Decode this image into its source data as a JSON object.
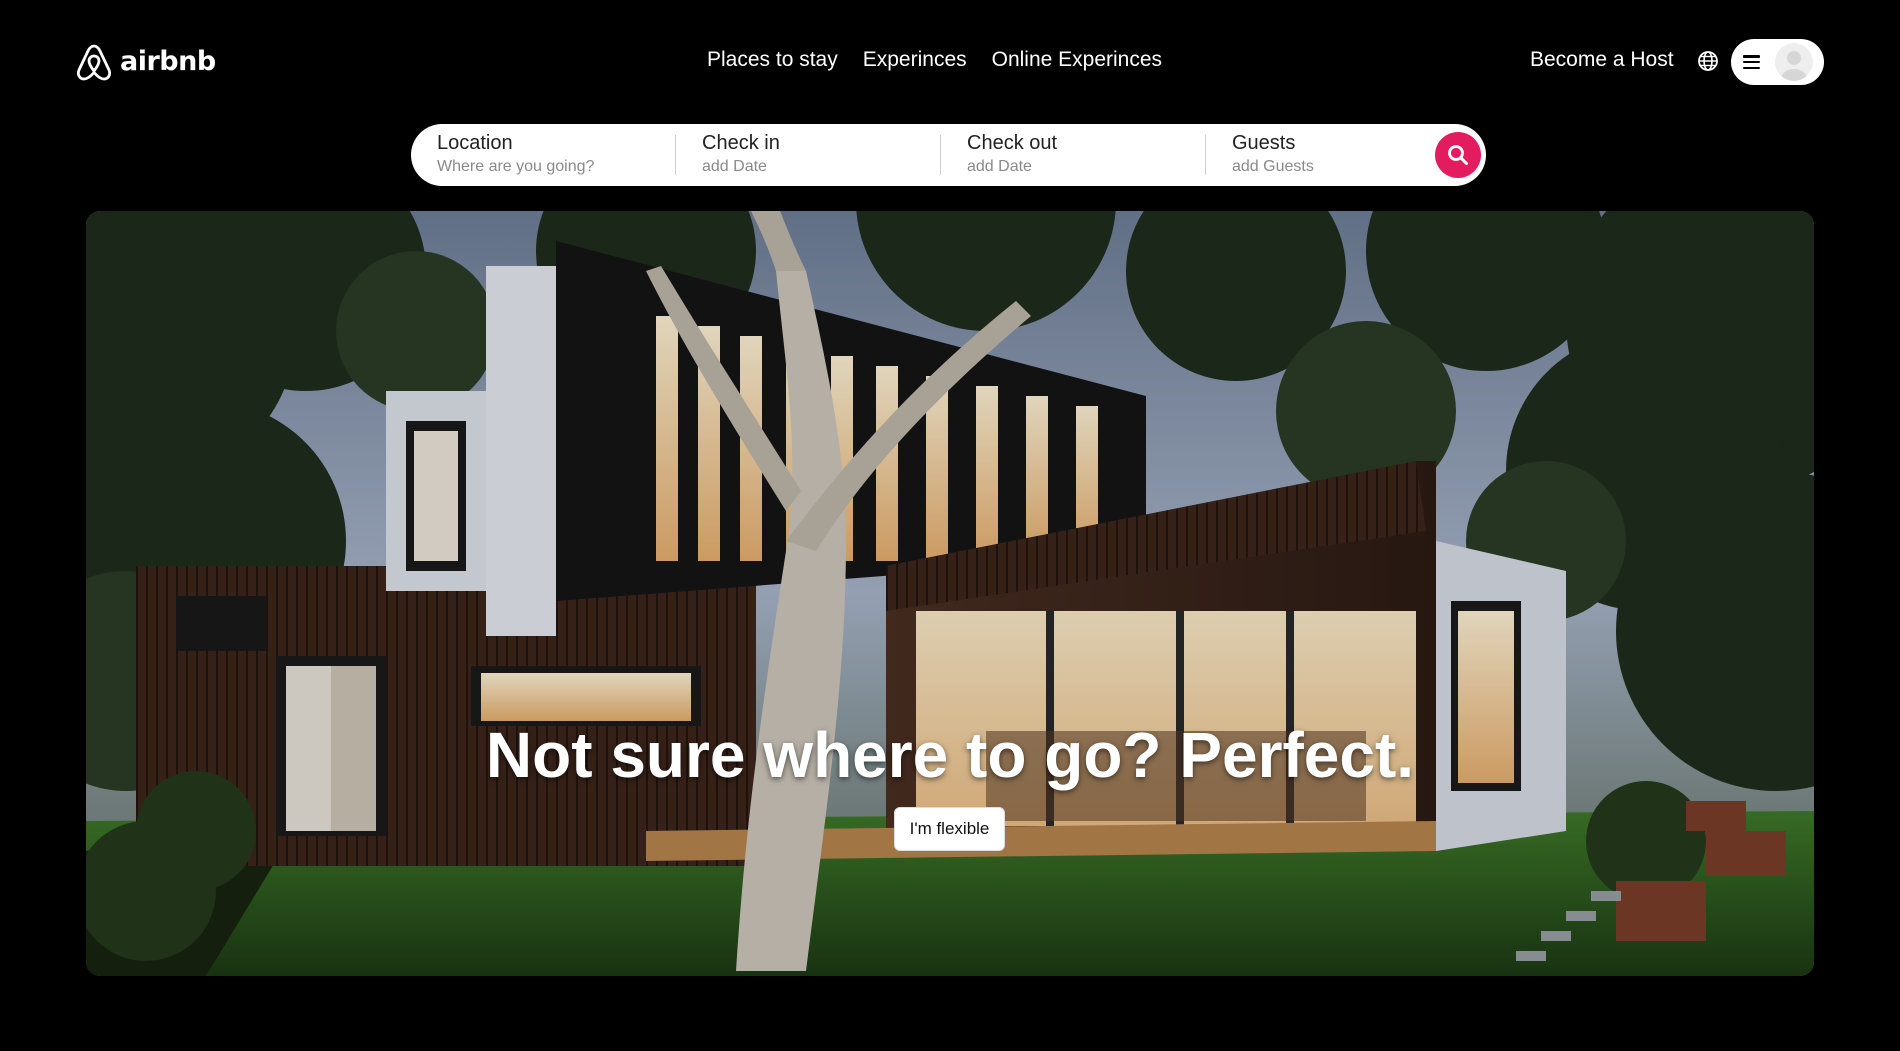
{
  "header": {
    "logo_text": "airbnb",
    "nav": [
      {
        "label": "Places to stay"
      },
      {
        "label": "Experinces"
      },
      {
        "label": "Online Experinces"
      }
    ],
    "host_label": "Become a Host",
    "globe_icon": "globe-icon",
    "menu_icon": "hamburger-menu-icon",
    "avatar_icon": "user-avatar-icon"
  },
  "search": {
    "fields": [
      {
        "label": "Location",
        "hint": "Where are you going?"
      },
      {
        "label": "Check in",
        "hint": "add Date"
      },
      {
        "label": "Check out",
        "hint": "add Date"
      },
      {
        "label": "Guests",
        "hint": "add Guests"
      }
    ],
    "button_icon": "search-icon",
    "button_color": "#e31c5f"
  },
  "hero": {
    "title": "Not sure where to go? Perfect.",
    "button_label": "I'm flexible"
  }
}
